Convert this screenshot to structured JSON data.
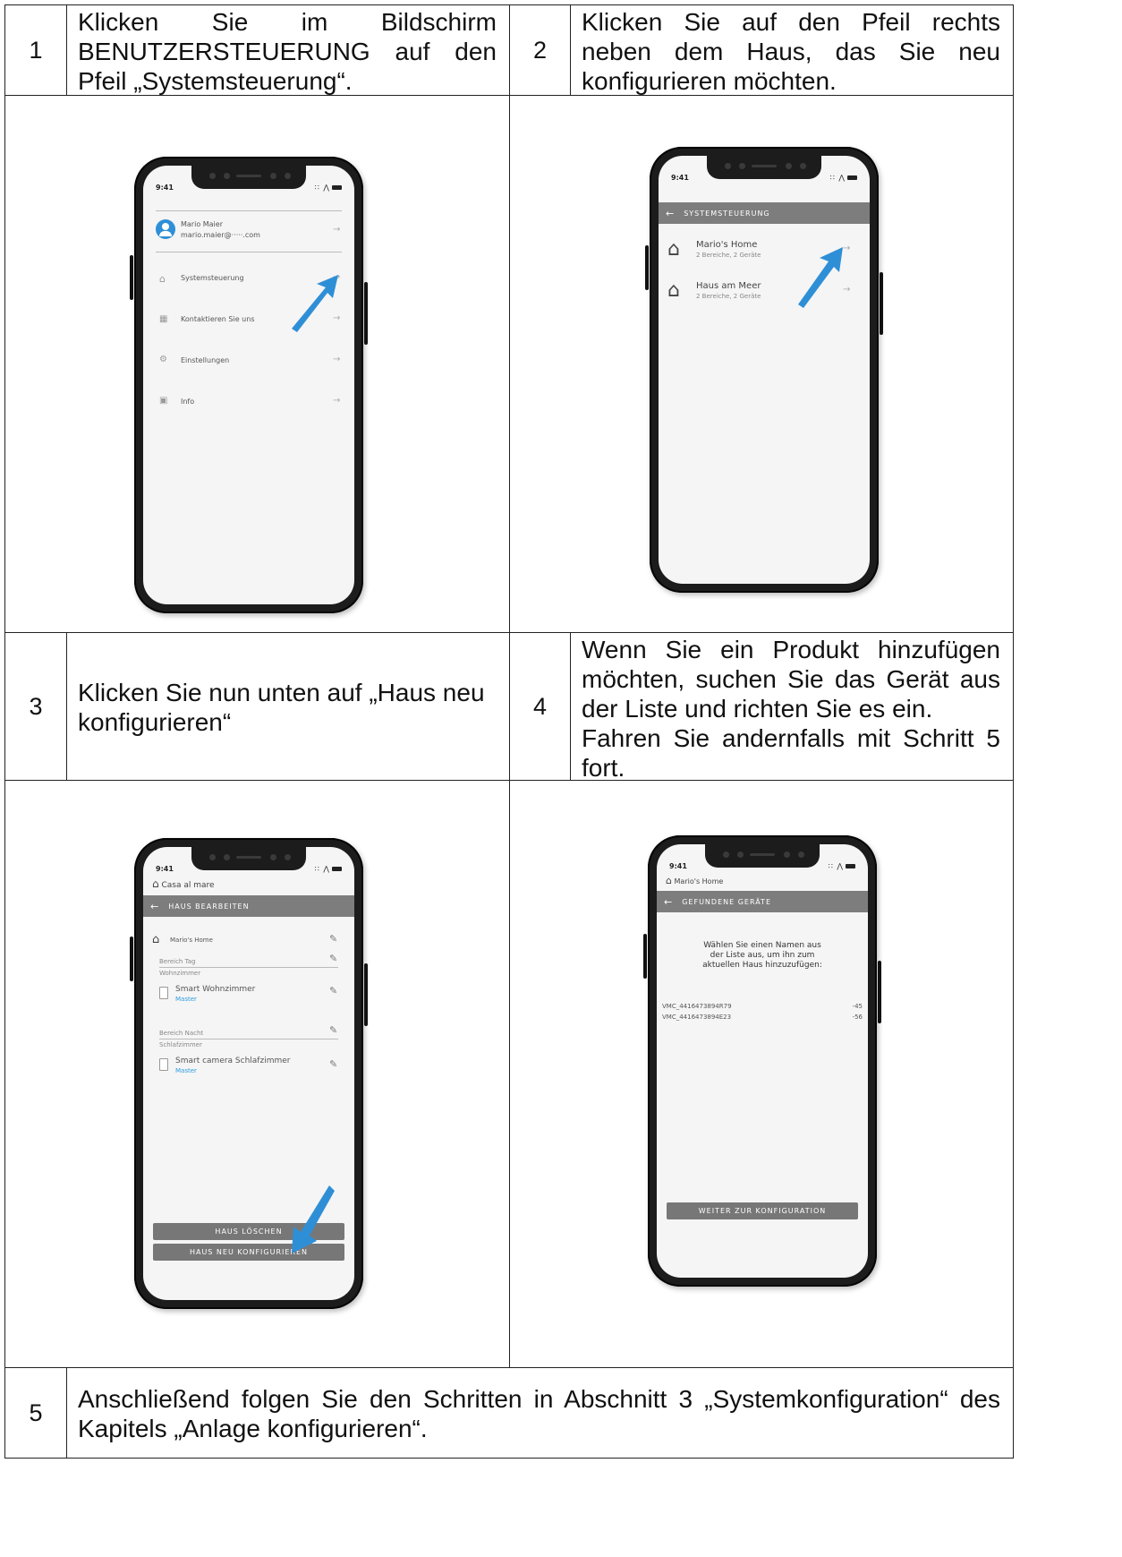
{
  "steps": [
    {
      "number": "1",
      "lines": [
        "Klicken Sie im Bildschirm",
        "BENUTZERSTEUERUNG auf den",
        "Pfeil „Systemsteuerung“."
      ]
    },
    {
      "number": "2",
      "lines": [
        "Klicken Sie auf den Pfeil rechts",
        "neben dem Haus, das Sie neu",
        "konfigurieren möchten."
      ]
    },
    {
      "number": "3",
      "lines": [
        "Klicken Sie nun unten auf „Haus neu",
        "konfigurieren“"
      ]
    },
    {
      "number": "4",
      "lines": [
        "Wenn Sie ein Produkt hinzufügen",
        "möchten, suchen Sie das Gerät aus",
        "der Liste und richten Sie es ein.",
        "Fahren Sie andernfalls mit Schritt 5",
        "fort."
      ]
    },
    {
      "number": "5",
      "lines": [
        "Anschließend folgen Sie den Schritten in Abschnitt 3 „Systemkonfiguration“ des",
        "Kapitels „Anlage konfigurieren“."
      ]
    }
  ],
  "phone_common": {
    "time": "9:41",
    "status_glyphs": "∷ ⋀"
  },
  "screen1": {
    "user_name": "Mario Maier",
    "user_email": "mario.maier@·····.com",
    "menu": [
      "Systemsteuerung",
      "Kontaktieren Sie uns",
      "Einstellungen",
      "Info"
    ]
  },
  "screen2": {
    "title": "SYSTEMSTEUERUNG",
    "houses": [
      {
        "name": "Mario's Home",
        "meta": "2 Bereiche, 2 Geräte"
      },
      {
        "name": "Haus am Meer",
        "meta": "2 Bereiche, 2 Geräte"
      }
    ]
  },
  "screen3": {
    "house_label": "Casa al mare",
    "title": "HAUS BEARBEITEN",
    "home_name": "Mario's Home",
    "area_day": "Bereich Tag",
    "room_day": "Wohnzimmer",
    "device_day": "Smart Wohnzimmer",
    "device_day_role": "Master",
    "area_night": "Bereich Nacht",
    "room_night": "Schlafzimmer",
    "device_night": "Smart camera Schlafzimmer",
    "device_night_role": "Master",
    "btn_delete": "HAUS LÖSCHEN",
    "btn_reconfigure": "HAUS NEU KONFIGURIEREN"
  },
  "screen4": {
    "house_label": "Mario's Home",
    "title": "GEFUNDENE GERÄTE",
    "prompt_lines": [
      "Wählen Sie einen Namen aus",
      "der Liste aus, um ihn zum",
      "aktuellen Haus hinzuzufügen:"
    ],
    "devices": [
      {
        "id": "VMC_4416473894R79",
        "signal": "-45"
      },
      {
        "id": "VMC_4416473894E23",
        "signal": "-56"
      }
    ],
    "btn_continue": "WEITER ZUR KONFIGURATION"
  },
  "colors": {
    "accent_arrow": "#2f8fd6",
    "header_bar": "#7d7d7d",
    "border": "#222222"
  }
}
